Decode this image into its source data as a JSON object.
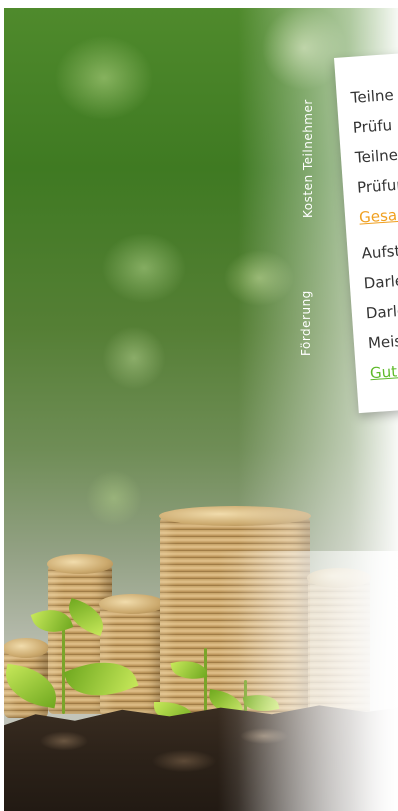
{
  "labels": {
    "kosten_teilnehmer": "Kosten Teilnehmer",
    "foerderung": "Förderung"
  },
  "card": {
    "rows": [
      {
        "text": "Teilne",
        "style": "normal"
      },
      {
        "text": "Prüfu",
        "style": "normal"
      },
      {
        "text": "Teilne",
        "style": "normal"
      },
      {
        "text": "Prüfur",
        "style": "normal"
      },
      {
        "text": "Gesam",
        "style": "orange"
      },
      {
        "text": "Aufstie",
        "style": "normal"
      },
      {
        "text": "Darleh",
        "style": "normal"
      },
      {
        "text": "Darleho",
        "style": "normal"
      },
      {
        "text": "Meisten",
        "style": "normal"
      },
      {
        "text": "Guthab",
        "style": "green"
      }
    ]
  },
  "colors": {
    "highlight_orange": "#f0a020",
    "highlight_green": "#5fba2a"
  }
}
